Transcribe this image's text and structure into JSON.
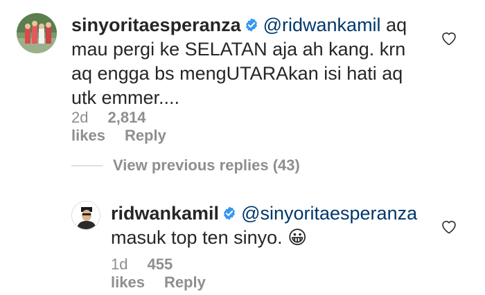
{
  "comment1": {
    "username": "sinyoritaesperanza",
    "mention": "@ridwankamil",
    "text_line1": " aq",
    "text_line2": "mau pergi ke SELATAN aja ah kang. krn",
    "text_line3": "aq engga bs mengUTARAkan isi hati aq",
    "text_line4": "utk emmer....",
    "time": "2d",
    "likes": "2,814 likes",
    "reply_label": "Reply"
  },
  "view_replies": {
    "label": "View previous replies (43)"
  },
  "comment2": {
    "username": "ridwankamil",
    "mention": "@sinyoritaesperanza",
    "text_line2": "masuk top ten sinyo. ",
    "emoji": "😀",
    "time": "1d",
    "likes": "455 likes",
    "reply_label": "Reply"
  },
  "colors": {
    "text": "#262626",
    "mention": "#00376b",
    "meta": "#8e8e8e",
    "verified": "#3897f0"
  },
  "icons": {
    "verified": "verified-badge-icon",
    "like": "heart-outline-icon"
  }
}
